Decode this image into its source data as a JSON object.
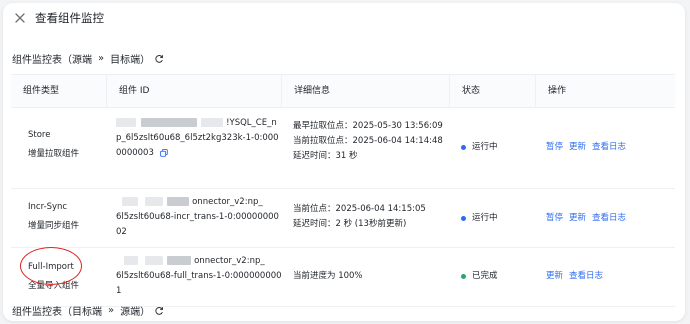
{
  "dialog": {
    "title": "查看组件监控"
  },
  "section1": {
    "prefix": "组件监控表（源端",
    "sep": "»",
    "suffix": "目标端）"
  },
  "section2": {
    "prefix": "组件监控表（目标端",
    "sep": "»",
    "suffix": "源端）"
  },
  "table": {
    "headers": [
      "组件类型",
      "组件 ID",
      "详细信息",
      "状态",
      "操作"
    ],
    "rows": [
      {
        "type1": "Store",
        "type2": "增量拉取组件",
        "id_lines": [
          "!YSQL_CE_n",
          "p_6l5zslt60u68_6l5zt2kg323k-1-0:000",
          "0000003"
        ],
        "details": [
          "最早拉取位点：2025-05-30 13:56:09",
          "当前拉取位点：2025-06-04 14:14:48",
          "延迟时间：31 秒"
        ],
        "status": "运行中",
        "actions": [
          "暂停",
          "更新",
          "查看日志"
        ]
      },
      {
        "type1": "Incr-Sync",
        "type2": "增量同步组件",
        "id_lines": [
          "onnector_v2:np_",
          "6l5zslt60u68-incr_trans-1-0:00000000",
          "02"
        ],
        "details": [
          "当前位点：2025-06-04 14:15:05",
          "延迟时间：2 秒 (13秒前更新)"
        ],
        "status": "运行中",
        "actions": [
          "暂停",
          "更新",
          "查看日志"
        ]
      },
      {
        "type1": "Full-Import",
        "type2": "全量导入组件",
        "id_lines": [
          "onnector_v2:np_",
          "6l5zslt60u68-full_trans-1-0:000000000",
          "1"
        ],
        "details": [
          "当前进度为 100%"
        ],
        "status": "已完成",
        "actions": [
          "更新",
          "查看日志"
        ]
      }
    ]
  },
  "colors": {
    "running": "#2e6bf0",
    "done": "#2ba471",
    "link": "#2e6bf0",
    "highlight": "#e02020"
  }
}
